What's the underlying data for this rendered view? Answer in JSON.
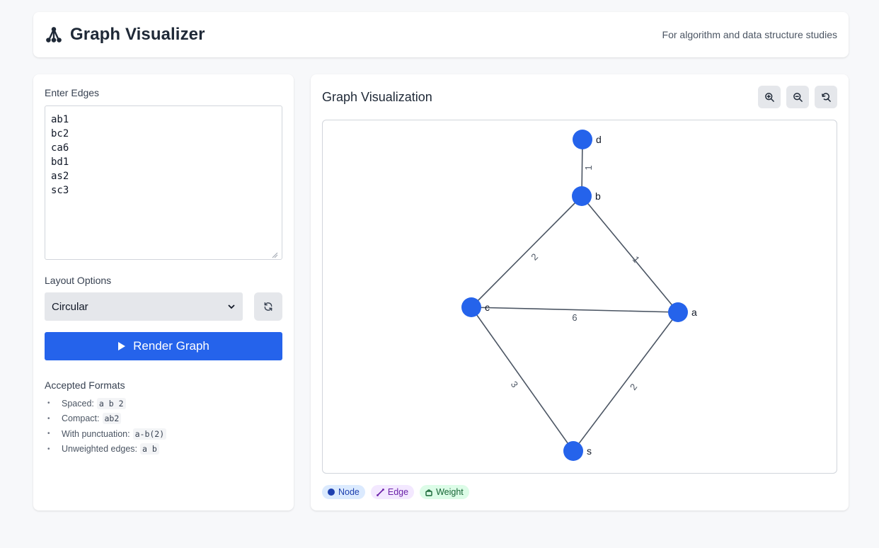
{
  "header": {
    "title": "Graph Visualizer",
    "subtitle": "For algorithm and data structure studies",
    "logo_icon": "graph-tree-icon"
  },
  "input": {
    "label": "Enter Edges",
    "value": "ab1\nbc2\nca6\nbd1\nas2\nsc3"
  },
  "layout": {
    "label": "Layout Options",
    "selected": "Circular",
    "refresh_icon": "refresh-icon"
  },
  "render_button": {
    "label": "Render Graph",
    "icon": "play-icon"
  },
  "formats": {
    "title": "Accepted Formats",
    "items": [
      {
        "label": "Spaced:",
        "example": "a b 2"
      },
      {
        "label": "Compact:",
        "example": "ab2"
      },
      {
        "label": "With punctuation:",
        "example": "a-b(2)"
      },
      {
        "label": "Unweighted edges:",
        "example": "a b"
      }
    ]
  },
  "visualization": {
    "title": "Graph Visualization",
    "controls": [
      "zoom-in-icon",
      "zoom-out-icon",
      "reset-zoom-icon"
    ]
  },
  "graph": {
    "node_color": "#2563eb",
    "edge_color": "#4b5563",
    "nodes": [
      {
        "id": "d",
        "label": "d"
      },
      {
        "id": "b",
        "label": "b"
      },
      {
        "id": "c",
        "label": "c"
      },
      {
        "id": "a",
        "label": "a"
      },
      {
        "id": "s",
        "label": "s"
      }
    ],
    "edges": [
      {
        "from": "b",
        "to": "d",
        "weight": "1"
      },
      {
        "from": "b",
        "to": "c",
        "weight": "2"
      },
      {
        "from": "b",
        "to": "a",
        "weight": "1"
      },
      {
        "from": "c",
        "to": "a",
        "weight": "6"
      },
      {
        "from": "c",
        "to": "s",
        "weight": "3"
      },
      {
        "from": "a",
        "to": "s",
        "weight": "2"
      }
    ]
  },
  "legend": {
    "node": "Node",
    "edge": "Edge",
    "weight": "Weight"
  },
  "colors": {
    "primary": "#2563eb",
    "node_chip_bg": "#dbeafe",
    "edge_chip_bg": "#f3e8ff",
    "weight_chip_bg": "#dcfce7"
  }
}
